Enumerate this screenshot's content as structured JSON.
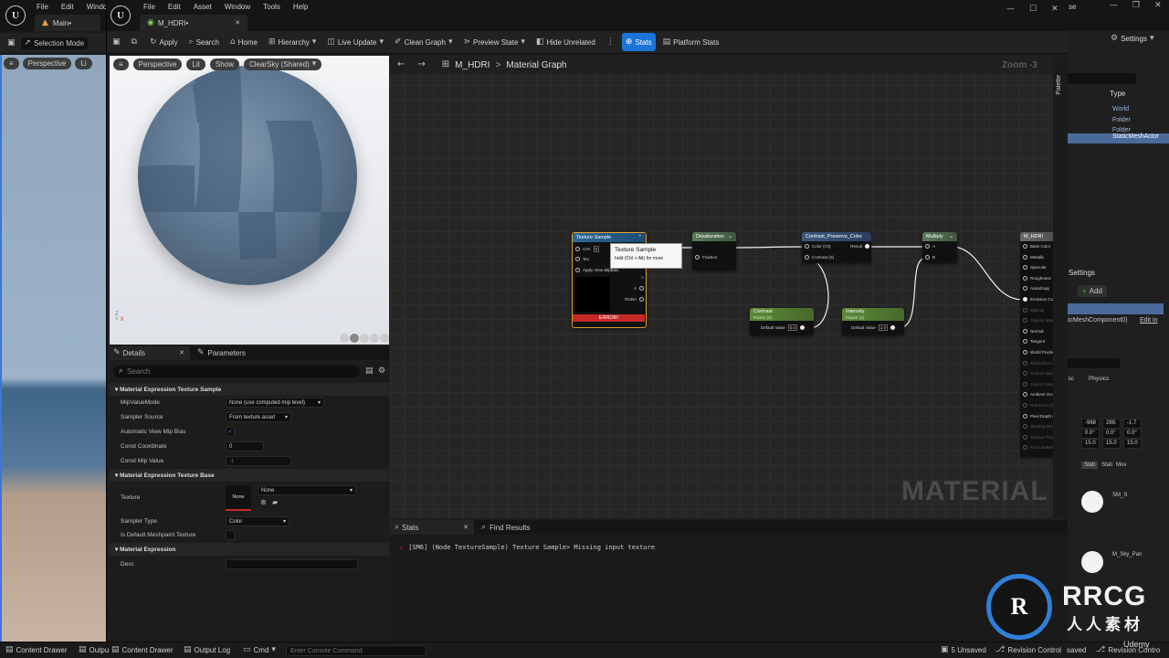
{
  "bg_editor": {
    "menu": [
      "File",
      "Edit",
      "Windo"
    ],
    "tab": "Main•",
    "mode": "Selection Mode",
    "viewport": {
      "perspective": "Perspective",
      "lit": "Li"
    },
    "right": {
      "title_fragment": "se",
      "settings": "Settings",
      "type_header": "Type",
      "types": [
        "World",
        "Folder",
        "Folder",
        "StaticMeshActor"
      ],
      "settings_tab": "Settings",
      "add": "Add",
      "component": "ticMeshComponent0)",
      "edit_in": "Edit in",
      "tabs": [
        "isc",
        "Physics"
      ],
      "xyz_rows": [
        [
          "-968",
          "289.",
          "-1.7"
        ],
        [
          "0.0°",
          "0.0°",
          "0.0°"
        ],
        [
          "15.0",
          "15.0",
          "15.0"
        ]
      ],
      "mobility": [
        "Stati",
        "Stati",
        "Mov"
      ],
      "mat1": "SM_S",
      "mat2": "M_Sky_Pan",
      "saved": "saved",
      "revision": "Revision Contro"
    }
  },
  "material_editor": {
    "menu": [
      "File",
      "Edit",
      "Asset",
      "Window",
      "Tools",
      "Help"
    ],
    "tab": "M_HDRI•",
    "toolbar": {
      "apply": "Apply",
      "search": "Search",
      "home": "Home",
      "hierarchy": "Hierarchy",
      "live_update": "Live Update",
      "clean_graph": "Clean Graph",
      "preview_state": "Preview State",
      "hide_unrelated": "Hide Unrelated",
      "stats": "Stats",
      "platform_stats": "Platform Stats"
    },
    "preview": {
      "perspective": "Perspective",
      "lit": "Lit",
      "show": "Show",
      "sky": "ClearSky (Shared)"
    },
    "details": {
      "tab_details": "Details",
      "tab_parameters": "Parameters",
      "search_placeholder": "Search",
      "section1": "Material Expression Texture Sample",
      "rows1": [
        {
          "label": "MipValueMode",
          "value": "None (use computed mip level)"
        },
        {
          "label": "Sampler Source",
          "value": "From texture asset"
        },
        {
          "label": "Automatic View Mip Bias",
          "value": "✓"
        },
        {
          "label": "Const Coordinate",
          "value": "0"
        },
        {
          "label": "Const Mip Value",
          "value": "-1"
        }
      ],
      "section2": "Material Expression Texture Base",
      "texture_label": "Texture",
      "texture_thumb": "None",
      "texture_value": "None",
      "sampler_type_label": "Sampler Type",
      "sampler_type_value": "Color",
      "meshpaint_label": "Is Default Meshpaint Texture",
      "section3": "Material Expression",
      "desc_label": "Desc"
    },
    "graph": {
      "breadcrumb_asset": "M_HDRI",
      "breadcrumb_sep": ">",
      "breadcrumb_graph": "Material Graph",
      "zoom": "Zoom -3",
      "palette": "Palette",
      "watermark": "MATERIAL",
      "nodes": {
        "texture_sample": {
          "title": "Texture Sample",
          "pins_in": [
            "UVs",
            "Tex",
            "Apply View MipBias"
          ],
          "pins_out": [
            "",
            "R",
            "G",
            "B",
            "A",
            "RGBA"
          ],
          "error": "ERROR!",
          "uv_val": "0"
        },
        "tooltip": {
          "title": "Texture Sample",
          "hint": "hold (Ctrl + Alt) for more"
        },
        "desaturation": {
          "title": "Desaturation",
          "pin": "Fraction"
        },
        "contrast_preserve": {
          "title": "Contrast_Preserve_Color",
          "in1": "Color (V3)",
          "in2": "Contrast (S)",
          "out": "Result"
        },
        "multiply": {
          "title": "Multiply",
          "a": "A",
          "b": "B"
        },
        "contrast_param": {
          "title": "Contrast",
          "sub": "Param (0)",
          "default_label": "Default Value",
          "default": "0.0"
        },
        "intensity_param": {
          "title": "Intensity",
          "sub": "Param (1)",
          "default_label": "Default Value",
          "default": "1.0"
        },
        "result": {
          "title": "M_HDRI",
          "pins": [
            "Base Color",
            "Metallic",
            "Specular",
            "Roughness",
            "Anisotropy",
            "Emissive Color",
            "Opacity",
            "Opacity Mask",
            "Normal",
            "Tangent",
            "World Position Offset",
            "Subsurface Color",
            "Custom Data 0",
            "Custom Data 1",
            "Ambient Occlusion",
            "Refraction (Disabled)",
            "Pixel Depth Offset",
            "Shading Model",
            "Surface Thickness",
            "Front Material"
          ]
        }
      }
    },
    "stats": {
      "tab_stats": "Stats",
      "tab_find": "Find Results",
      "message": "[SM6] (Node TextureSample) Texture Sample> Missing input texture"
    }
  },
  "bottom_bar": {
    "content_drawer": "Content Drawer",
    "output_log": "Output Log",
    "cmd": "Cmd",
    "console_placeholder": "Enter Console Command",
    "unsaved": "5 Unsaved",
    "revision_control": "Revision Control",
    "left_content": "Content Drawer",
    "left_output": "Outpu"
  },
  "watermark": {
    "brand": "RRCG",
    "sub": "人人素材",
    "site": "Udemy"
  }
}
